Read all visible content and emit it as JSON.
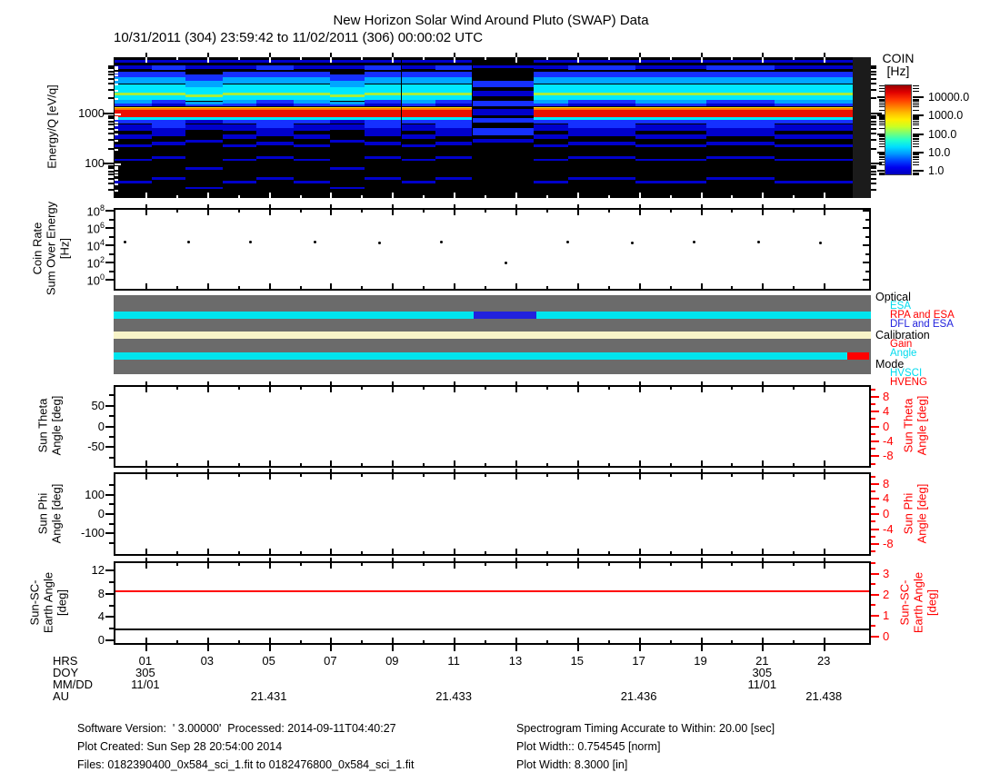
{
  "title": "New Horizon Solar Wind Around Pluto (SWAP) Data",
  "subtitle": "10/31/2011 (304) 23:59:42 to 11/02/2011 (306) 00:00:02 UTC",
  "x_axis": {
    "hrs_label": "HRS",
    "doy_label": "DOY",
    "mmdd_label": "MM/DD",
    "au_label": "AU",
    "hour_tick_labels": [
      {
        "hour": 1,
        "text": "01"
      },
      {
        "hour": 3,
        "text": "03"
      },
      {
        "hour": 5,
        "text": "05"
      },
      {
        "hour": 7,
        "text": "07"
      },
      {
        "hour": 9,
        "text": "09"
      },
      {
        "hour": 11,
        "text": "11"
      },
      {
        "hour": 13,
        "text": "13"
      },
      {
        "hour": 15,
        "text": "15"
      },
      {
        "hour": 17,
        "text": "17"
      },
      {
        "hour": 19,
        "text": "19"
      },
      {
        "hour": 21,
        "text": "21"
      },
      {
        "hour": 23,
        "text": "23"
      }
    ],
    "doy_values": [
      {
        "hour": 1,
        "text": "305"
      },
      {
        "hour": 21,
        "text": "305"
      }
    ],
    "mmdd_values": [
      {
        "hour": 1,
        "text": "11/01"
      },
      {
        "hour": 21,
        "text": "11/01"
      }
    ],
    "au_values": [
      {
        "hour": 5,
        "text": "21.431"
      },
      {
        "hour": 11,
        "text": "21.433"
      },
      {
        "hour": 17,
        "text": "21.436"
      },
      {
        "hour": 23,
        "text": "21.438"
      }
    ]
  },
  "footer": {
    "left": [
      "Software Version:  ' 3.00000'  Processed: 2014-09-11T04:40:27",
      "Plot Created: Sun Sep 28 20:54:00 2014",
      "Files: 0182390400_0x584_sci_1.fit to 0182476800_0x584_sci_1.fit"
    ],
    "right": [
      "Spectrogram Timing Accurate to Within: 20.00 [sec]",
      "Plot Width:: 0.754545 [norm]",
      "Plot Width: 8.3000 [in]"
    ]
  },
  "chart_data": [
    {
      "id": "energy_spectrogram",
      "type": "heatmap",
      "ylabel": "Energy/Q [eV/q]",
      "yscale": "log",
      "ylim": [
        20,
        13000
      ],
      "ytick_labels": [
        "1000",
        "100"
      ],
      "xlim_hours": [
        0,
        24
      ],
      "background": "#000000",
      "right_gap_color": "#1b1b1b",
      "colorbar": {
        "title": "COIN",
        "units": "[Hz]",
        "scale": "log",
        "tick_labels": [
          "10000.0",
          "1000.0",
          "100.0",
          "10.0",
          "1.0"
        ],
        "gradient": [
          "#990000",
          "#e00000",
          "#ff3300",
          "#ff7700",
          "#ffbb00",
          "#ffee00",
          "#ccff22",
          "#77ff77",
          "#22ffcc",
          "#00ddff",
          "#0099ff",
          "#0044ff",
          "#0000ee",
          "#0000bb"
        ]
      },
      "palette": {
        "b": "#0000cc",
        "B": "#1530ff",
        "lb": "#00a6ff",
        "c": "#00e8ff",
        "g": "#a8ee3c",
        "y": "#ffe400",
        "o": "#ff7a00",
        "r": "#ea0e00"
      },
      "band_profiles": {
        "P1": [
          [
            0.02,
            0.02,
            "b"
          ],
          [
            0.055,
            0.03,
            "b"
          ],
          [
            0.1,
            0.04,
            "B"
          ],
          [
            0.14,
            0.05,
            "lb"
          ],
          [
            0.19,
            0.06,
            "c"
          ],
          [
            0.25,
            0.018,
            "g"
          ],
          [
            0.268,
            0.035,
            "c"
          ],
          [
            0.303,
            0.025,
            "lb"
          ],
          [
            0.328,
            0.02,
            "B"
          ],
          [
            0.352,
            0.012,
            "y"
          ],
          [
            0.364,
            0.012,
            "o"
          ],
          [
            0.376,
            0.048,
            "r"
          ],
          [
            0.424,
            0.022,
            "c"
          ],
          [
            0.446,
            0.028,
            "B"
          ],
          [
            0.474,
            0.05,
            "b"
          ],
          [
            0.55,
            0.028,
            "b"
          ],
          [
            0.62,
            0.02,
            "b"
          ],
          [
            0.72,
            0.018,
            "b"
          ],
          [
            0.88,
            0.018,
            "b"
          ]
        ],
        "P2": [
          [
            0.02,
            0.02,
            "b"
          ],
          [
            0.06,
            0.03,
            "B"
          ],
          [
            0.1,
            0.04,
            "B"
          ],
          [
            0.14,
            0.05,
            "lb"
          ],
          [
            0.19,
            0.06,
            "c"
          ],
          [
            0.25,
            0.018,
            "g"
          ],
          [
            0.268,
            0.035,
            "c"
          ],
          [
            0.303,
            0.025,
            "B"
          ],
          [
            0.328,
            0.02,
            "b"
          ],
          [
            0.352,
            0.012,
            "y"
          ],
          [
            0.364,
            0.012,
            "o"
          ],
          [
            0.376,
            0.048,
            "r"
          ],
          [
            0.424,
            0.022,
            "c"
          ],
          [
            0.446,
            0.06,
            "B"
          ],
          [
            0.506,
            0.055,
            "b"
          ],
          [
            0.6,
            0.025,
            "b"
          ],
          [
            0.7,
            0.02,
            "b"
          ],
          [
            0.85,
            0.02,
            "b"
          ]
        ],
        "P3": [
          [
            0.02,
            0.02,
            "b"
          ],
          [
            0.055,
            0.03,
            "b"
          ],
          [
            0.12,
            0.045,
            "B"
          ],
          [
            0.165,
            0.05,
            "lb"
          ],
          [
            0.215,
            0.05,
            "c"
          ],
          [
            0.265,
            0.018,
            "g"
          ],
          [
            0.283,
            0.03,
            "c"
          ],
          [
            0.313,
            0.02,
            "lb"
          ],
          [
            0.333,
            0.019,
            "B"
          ],
          [
            0.352,
            0.012,
            "y"
          ],
          [
            0.364,
            0.012,
            "o"
          ],
          [
            0.376,
            0.048,
            "r"
          ],
          [
            0.424,
            0.022,
            "c"
          ],
          [
            0.446,
            0.028,
            "b"
          ],
          [
            0.474,
            0.04,
            "b"
          ],
          [
            0.59,
            0.02,
            "b"
          ],
          [
            0.78,
            0.018,
            "b"
          ],
          [
            0.92,
            0.016,
            "b"
          ]
        ],
        "CAL": [
          [
            0.06,
            0.02,
            "b"
          ],
          [
            0.17,
            0.04,
            "B"
          ],
          [
            0.24,
            0.04,
            "b"
          ],
          [
            0.31,
            0.04,
            "B"
          ],
          [
            0.37,
            0.04,
            "b"
          ],
          [
            0.43,
            0.035,
            "B"
          ],
          [
            0.5,
            0.055,
            "B"
          ],
          [
            0.58,
            0.03,
            "b"
          ]
        ]
      },
      "segments": [
        {
          "h0": 0.0,
          "h1": 1.2,
          "profile": "P1"
        },
        {
          "h0": 1.2,
          "h1": 2.3,
          "profile": "P2"
        },
        {
          "h0": 2.3,
          "h1": 3.5,
          "profile": "P3"
        },
        {
          "h0": 3.5,
          "h1": 4.6,
          "profile": "P1"
        },
        {
          "h0": 4.6,
          "h1": 5.8,
          "profile": "P2"
        },
        {
          "h0": 5.8,
          "h1": 7.0,
          "profile": "P1"
        },
        {
          "h0": 7.0,
          "h1": 8.1,
          "profile": "P3"
        },
        {
          "h0": 8.1,
          "h1": 9.3,
          "profile": "P2"
        },
        {
          "h0": 9.3,
          "h1": 10.4,
          "profile": "P1"
        },
        {
          "h0": 10.4,
          "h1": 11.6,
          "profile": "P2"
        },
        {
          "h0": 11.6,
          "h1": 13.6,
          "profile": "CAL"
        },
        {
          "h0": 13.6,
          "h1": 14.7,
          "profile": "P1"
        },
        {
          "h0": 14.7,
          "h1": 16.9,
          "profile": "P2"
        },
        {
          "h0": 16.9,
          "h1": 19.2,
          "profile": "P1"
        },
        {
          "h0": 19.2,
          "h1": 21.4,
          "profile": "P2"
        },
        {
          "h0": 21.4,
          "h1": 23.93,
          "profile": "P1"
        }
      ]
    },
    {
      "id": "coin_rate",
      "type": "scatter",
      "ylabel_lines": [
        "Coin Rate",
        "Sum Over Energy",
        "[Hz]"
      ],
      "yscale": "log",
      "ylim_exp": [
        0,
        8
      ],
      "ytick_exponents": [
        "8",
        "6",
        "4",
        "2",
        "0"
      ],
      "points": [
        {
          "hour": 0.35,
          "hz": 21000
        },
        {
          "hour": 2.4,
          "hz": 22000
        },
        {
          "hour": 4.4,
          "hz": 21000
        },
        {
          "hour": 6.5,
          "hz": 23000
        },
        {
          "hour": 8.6,
          "hz": 18000
        },
        {
          "hour": 10.6,
          "hz": 21000
        },
        {
          "hour": 12.7,
          "hz": 100
        },
        {
          "hour": 14.7,
          "hz": 22000
        },
        {
          "hour": 16.8,
          "hz": 20000
        },
        {
          "hour": 18.8,
          "hz": 22000
        },
        {
          "hour": 20.9,
          "hz": 21000
        },
        {
          "hour": 22.9,
          "hz": 19000
        }
      ]
    },
    {
      "id": "instrument_status",
      "type": "state-bars",
      "background": "#6b6b6b",
      "bars": [
        {
          "name": "optical",
          "y_frac": 0.207,
          "segments": [
            {
              "x0": 0.0,
              "x1": 0.475,
              "state": "ESA",
              "color": "#00e5ee"
            },
            {
              "x0": 0.475,
              "x1": 0.558,
              "state": "DFL and ESA",
              "color": "#2222dd"
            },
            {
              "x0": 0.558,
              "x1": 1.0,
              "state": "ESA",
              "color": "#00e5ee"
            }
          ]
        },
        {
          "name": "calibration",
          "y_frac": 0.46,
          "segments": [
            {
              "x0": 0.0,
              "x1": 1.0,
              "state": "",
              "color": "#f7f3c8"
            }
          ]
        },
        {
          "name": "mode",
          "y_frac": 0.724,
          "segments": [
            {
              "x0": 0.0,
              "x1": 0.969,
              "state": "HVSCI",
              "color": "#00e5ee"
            },
            {
              "x0": 0.969,
              "x1": 0.998,
              "state": "HVENG",
              "color": "#ff0000"
            }
          ]
        }
      ],
      "legend": [
        {
          "title": "Optical",
          "items": [
            {
              "label": "ESA",
              "color": "#00dbee"
            },
            {
              "label": "RPA and ESA",
              "color": "#ff0000"
            },
            {
              "label": "DFL and ESA",
              "color": "#2222dd"
            }
          ]
        },
        {
          "title": "Calibration",
          "items": [
            {
              "label": "Gain",
              "color": "#ff0000"
            },
            {
              "label": "Angle",
              "color": "#00dbee"
            }
          ]
        },
        {
          "title": "Mode",
          "items": [
            {
              "label": "HVSCI",
              "color": "#00dbee"
            },
            {
              "label": "HVENG",
              "color": "#ff0000"
            }
          ]
        }
      ]
    },
    {
      "id": "sun_theta_angle",
      "type": "line",
      "ylabel_lines": [
        "Sun Theta",
        "Angle [deg]"
      ],
      "left_tick_labels": [
        "50",
        "0",
        "-50"
      ],
      "right_tick_labels": [
        "8",
        "4",
        "0",
        "-4",
        "-8"
      ],
      "right_label_lines": [
        "Sun Theta",
        "Angle [deg]"
      ],
      "right_axis_color": "#ff0000",
      "series": []
    },
    {
      "id": "sun_phi_angle",
      "type": "line",
      "ylabel_lines": [
        "Sun Phi",
        "Angle [deg]"
      ],
      "left_tick_labels": [
        "100",
        "0",
        "-100"
      ],
      "right_tick_labels": [
        "8",
        "4",
        "0",
        "-4",
        "-8"
      ],
      "right_label_lines": [
        "Sun Phi",
        "Angle [deg]"
      ],
      "right_axis_color": "#ff0000",
      "series": []
    },
    {
      "id": "sun_sc_earth_angle",
      "type": "line",
      "ylabel_lines": [
        "Sun-SC-",
        "Earth Angle",
        "[deg]"
      ],
      "left_tick_labels": [
        "12",
        "8",
        "4",
        "0"
      ],
      "right_tick_labels": [
        "3",
        "2",
        "1",
        "0"
      ],
      "right_label_lines": [
        "Sun-SC-",
        "Earth Angle",
        "[deg]"
      ],
      "right_axis_color": "#ff0000",
      "ylim_left": [
        -0.8,
        13.6
      ],
      "lines": [
        {
          "name": "red-line",
          "color": "#ff0000",
          "value": 8.4
        },
        {
          "name": "black-line",
          "color": "#000000",
          "value": 1.8
        }
      ]
    }
  ]
}
